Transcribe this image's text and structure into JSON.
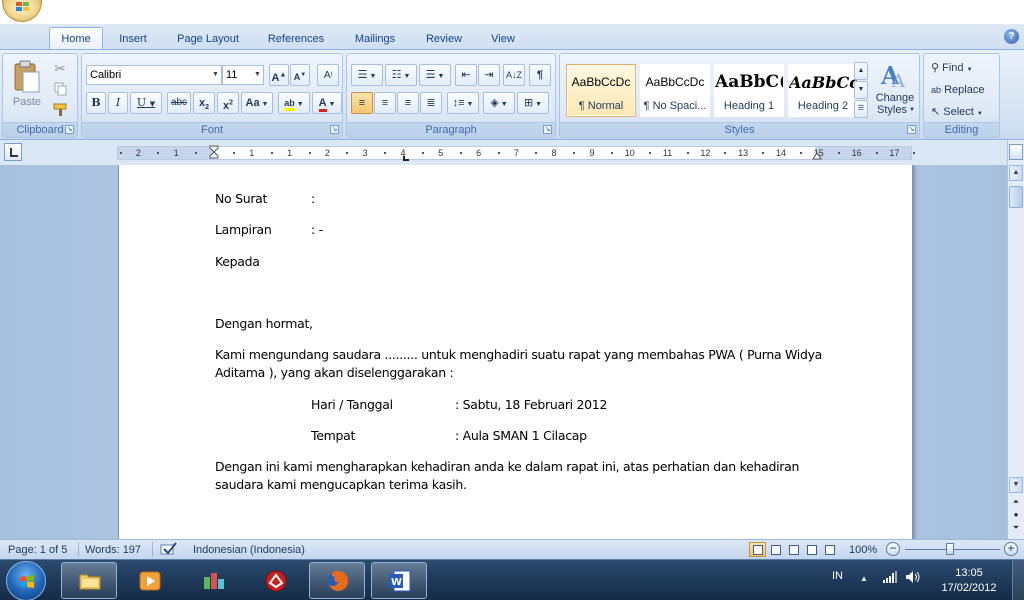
{
  "ribbon": {
    "tabs": [
      "Home",
      "Insert",
      "Page Layout",
      "References",
      "Mailings",
      "Review",
      "View"
    ],
    "active_tab": "Home",
    "clipboard": {
      "label": "Clipboard",
      "paste": "Paste"
    },
    "font": {
      "label": "Font",
      "font_name": "Calibri",
      "font_size": "11"
    },
    "paragraph": {
      "label": "Paragraph"
    },
    "styles": {
      "label": "Styles",
      "items": [
        {
          "sample": "AaBbCcDc",
          "name": "¶ Normal"
        },
        {
          "sample": "AaBbCcDc",
          "name": "¶ No Spaci..."
        },
        {
          "sample": "AaBbC(",
          "name": "Heading 1"
        },
        {
          "sample": "AaBbCc",
          "name": "Heading 2"
        }
      ],
      "change_styles_line1": "Change",
      "change_styles_line2": "Styles"
    },
    "editing": {
      "label": "Editing",
      "find": "Find",
      "replace": "Replace",
      "select": "Select"
    }
  },
  "ruler": {
    "numbers": [
      "2",
      "1",
      "1",
      "1",
      "2",
      "3",
      "4",
      "5",
      "6",
      "7",
      "8",
      "9",
      "10",
      "11",
      "12",
      "13",
      "14",
      "15",
      "16",
      "17",
      "18"
    ]
  },
  "document": {
    "no_surat_label": "No Surat",
    "no_surat_value": ":",
    "lampiran_label": "Lampiran",
    "lampiran_value": ": -",
    "kepada": "Kepada",
    "salutation": "Dengan hormat,",
    "body1_line1": "Kami mengundang saudara ......... untuk menghadiri suatu rapat yang membahas PWA ( Purna Widya",
    "body1_line2": "Aditama ), yang akan diselenggarakan :",
    "hari_label": "Hari / Tanggal",
    "hari_value": ": Sabtu, 18  Februari 2012",
    "tempat_label": "Tempat",
    "tempat_value": ": Aula SMAN 1 Cilacap",
    "closing_line1": "Dengan ini kami mengharapkan kehadiran anda ke dalam rapat ini,  atas perhatian dan kehadiran",
    "closing_line2": "saudara kami mengucapkan terima kasih."
  },
  "statusbar": {
    "page": "Page: 1 of 5",
    "words": "Words: 197",
    "language": "Indonesian (Indonesia)",
    "zoom": "100%",
    "zoom_level_percent": 100
  },
  "taskbar": {
    "language": "IN",
    "time": "13:05",
    "date": "17/02/2012"
  },
  "colors": {
    "ribbon_text": "#15428b",
    "tab_active_border": "#8db2e3",
    "doc_background": "#a7c0de",
    "taskbar": "#1f3a5b",
    "selected_style": "#fde8b4"
  }
}
